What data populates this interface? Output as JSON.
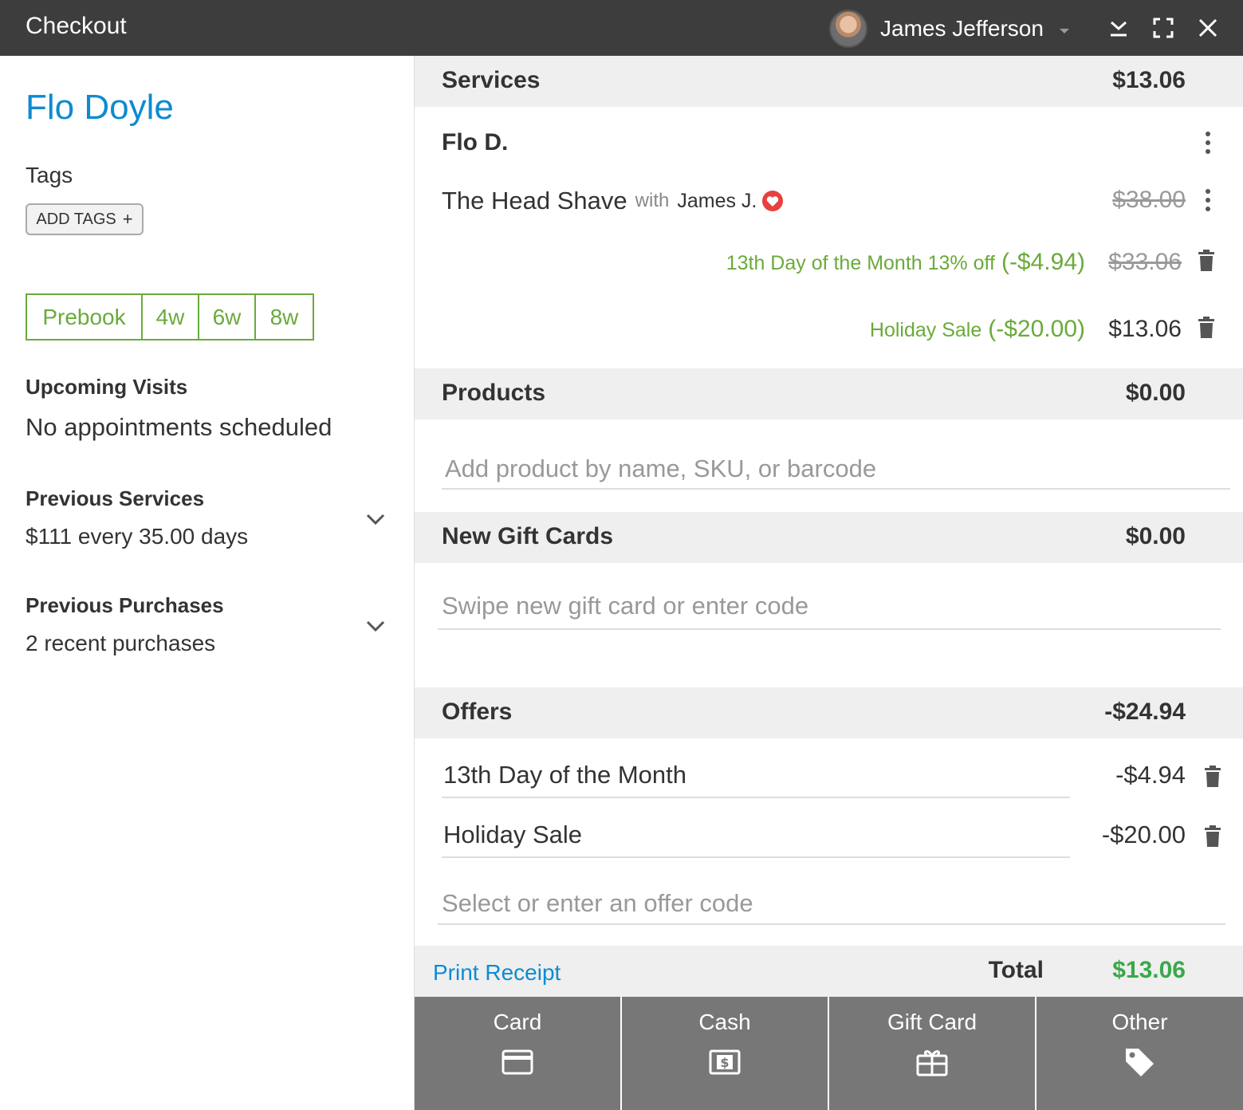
{
  "header": {
    "title": "Checkout",
    "user_name": "James Jefferson"
  },
  "client": {
    "name": "Flo Doyle",
    "tags_label": "Tags",
    "add_tags_label": "ADD TAGS",
    "prebook": {
      "main": "Prebook",
      "options": [
        "4w",
        "6w",
        "8w"
      ]
    },
    "upcoming": {
      "label": "Upcoming Visits",
      "value": "No appointments scheduled"
    },
    "previous_services": {
      "label": "Previous Services",
      "value": "$111 every 35.00 days"
    },
    "previous_purchases": {
      "label": "Previous Purchases",
      "value": "2 recent purchases"
    }
  },
  "services": {
    "label": "Services",
    "total": "$13.06",
    "client_short": "Flo D.",
    "item": {
      "name": "The Head Shave",
      "with": "with",
      "provider": "James J.",
      "original_price": "$38.00"
    },
    "discounts": [
      {
        "label": "13th Day of the Month 13% off",
        "amount": "(-$4.94)",
        "price": "$33.06",
        "struck": true
      },
      {
        "label": "Holiday Sale",
        "amount": "(-$20.00)",
        "price": "$13.06",
        "struck": false
      }
    ]
  },
  "products": {
    "label": "Products",
    "total": "$0.00",
    "placeholder": "Add product by name, SKU, or barcode"
  },
  "gift_cards": {
    "label": "New Gift Cards",
    "total": "$0.00",
    "placeholder": "Swipe new gift card or enter code"
  },
  "offers": {
    "label": "Offers",
    "total": "-$24.94",
    "items": [
      {
        "name": "13th Day of the Month",
        "amount": "-$4.94"
      },
      {
        "name": "Holiday Sale",
        "amount": "-$20.00"
      }
    ],
    "placeholder": "Select or enter an offer code"
  },
  "footer": {
    "print_receipt": "Print Receipt",
    "total_label": "Total",
    "total_value": "$13.06"
  },
  "payment_methods": [
    {
      "label": "Card",
      "icon": "credit-card-icon"
    },
    {
      "label": "Cash",
      "icon": "cash-icon"
    },
    {
      "label": "Gift Card",
      "icon": "gift-card-icon"
    },
    {
      "label": "Other",
      "icon": "tag-icon"
    }
  ],
  "colors": {
    "header_bg": "#3d3d3d",
    "link_blue": "#0d8bd1",
    "discount_green": "#6aaa3a",
    "total_green": "#3aa84a",
    "heart_red": "#e84040",
    "button_gray": "#777777"
  }
}
